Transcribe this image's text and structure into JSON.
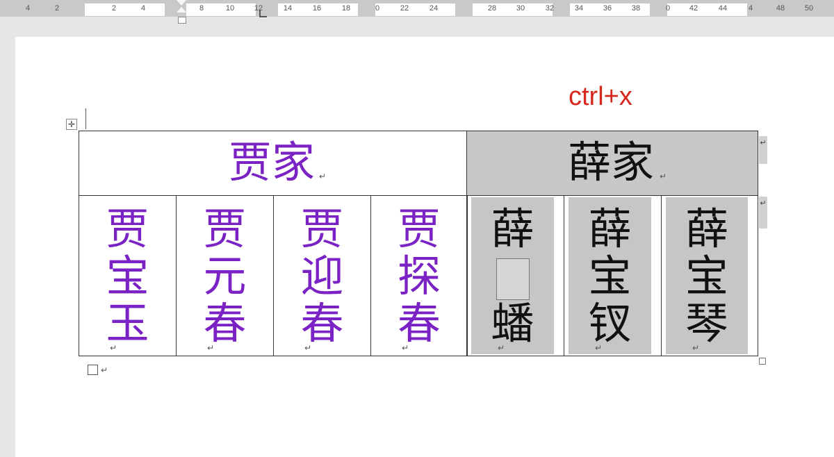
{
  "ruler": {
    "ticks": [
      "4",
      "2",
      "2",
      "4",
      "8",
      "10",
      "12",
      "14",
      "16",
      "18",
      "0",
      "22",
      "24",
      "28",
      "30",
      "32",
      "34",
      "36",
      "38",
      "0",
      "42",
      "44",
      "4",
      "48",
      "50"
    ]
  },
  "annotation": {
    "text": "ctrl+x",
    "color": "#d6281c"
  },
  "colors": {
    "jia": "#7b22c4",
    "xue": "#111111",
    "highlight": "#c8c8c8"
  },
  "table": {
    "header_left": "贾家",
    "header_right": "薛家",
    "paragraph_mark": "↵",
    "jia_members": [
      [
        "贾",
        "宝",
        "玉"
      ],
      [
        "贾",
        "元",
        "春"
      ],
      [
        "贾",
        "迎",
        "春"
      ],
      [
        "贾",
        "探",
        "春"
      ]
    ],
    "xue_members": [
      [
        "薛",
        "",
        "蟠"
      ],
      [
        "薛",
        "宝",
        "钗"
      ],
      [
        "薛",
        "宝",
        "琴"
      ]
    ]
  }
}
